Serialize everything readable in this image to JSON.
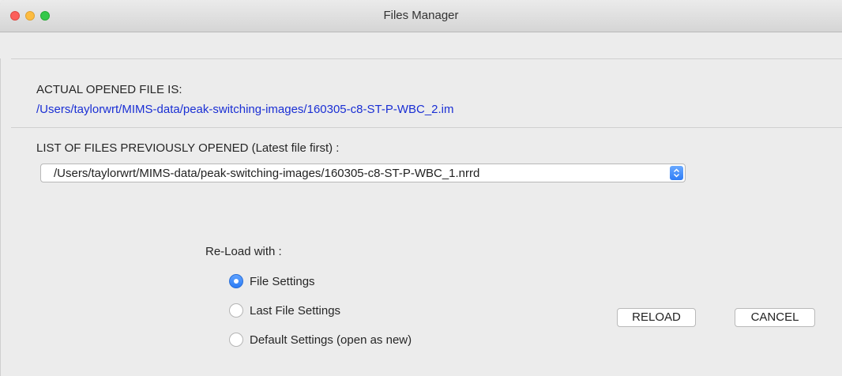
{
  "window": {
    "title": "Files Manager"
  },
  "current": {
    "heading": "ACTUAL OPENED FILE IS:",
    "path": "/Users/taylorwrt/MIMS-data/peak-switching-images/160305-c8-ST-P-WBC_2.im"
  },
  "history": {
    "heading": "LIST OF FILES PREVIOUSLY OPENED (Latest file first) :",
    "selected": "/Users/taylorwrt/MIMS-data/peak-switching-images/160305-c8-ST-P-WBC_1.nrrd"
  },
  "reload": {
    "heading": "Re-Load with :",
    "options": [
      {
        "label": "File Settings",
        "selected": true
      },
      {
        "label": "Last File Settings",
        "selected": false
      },
      {
        "label": "Default Settings (open as new)",
        "selected": false
      }
    ]
  },
  "buttons": {
    "reload": "RELOAD",
    "cancel": "CANCEL"
  },
  "colors": {
    "link": "#1a2fd4",
    "accent": "#2c7cf5"
  }
}
